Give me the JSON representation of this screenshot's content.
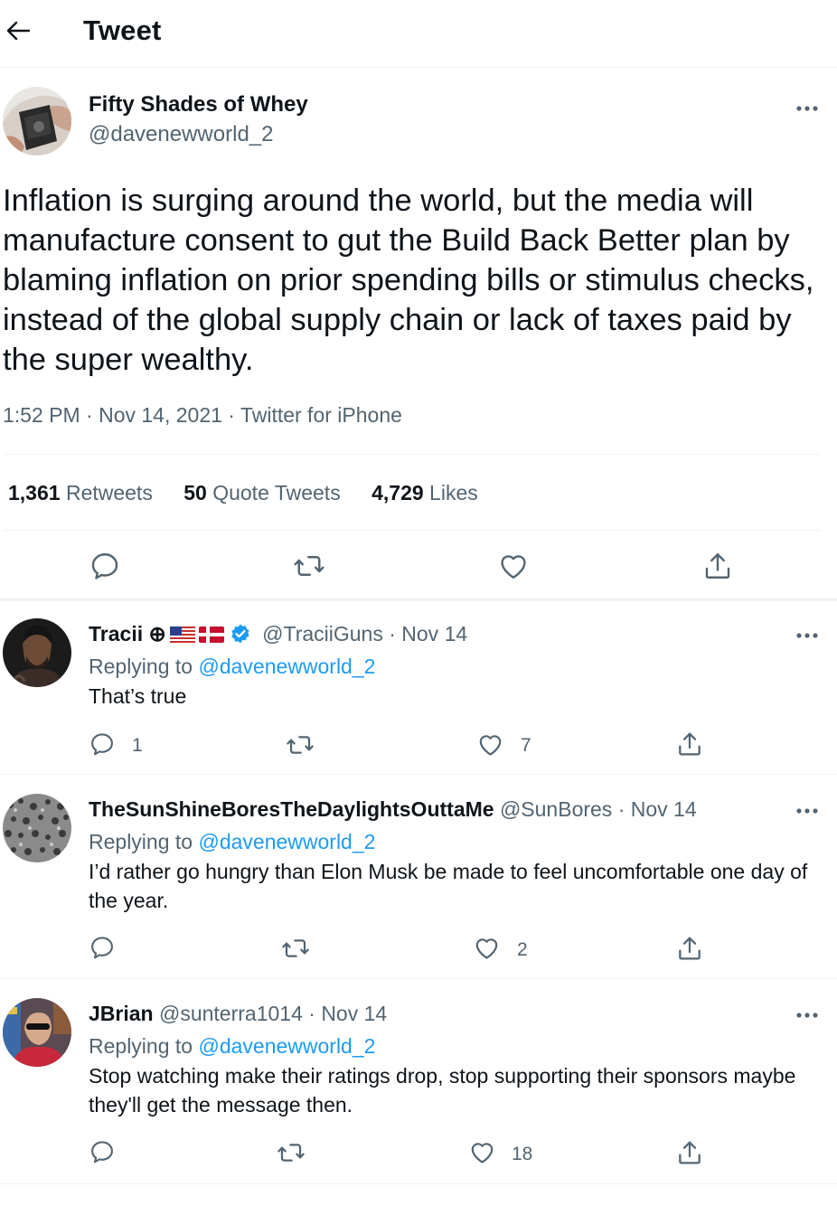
{
  "header": {
    "title": "Tweet"
  },
  "tweet": {
    "author_name": "Fifty Shades of Whey",
    "author_handle": "@davenewworld_2",
    "text": "Inflation is surging around the world, but the media will manufacture consent to gut the Build Back Better plan by blaming inflation on prior spending bills or stimulus checks, instead of the global supply chain or lack of taxes paid by the super wealthy.",
    "meta": "1:52 PM · Nov 14, 2021 · Twitter for iPhone",
    "stats": {
      "retweets_num": "1,361",
      "retweets_label": " Retweets",
      "quotes_num": "50",
      "quotes_label": " Quote Tweets",
      "likes_num": "4,729",
      "likes_label": " Likes"
    }
  },
  "replies": [
    {
      "name": "Tracii ⊕",
      "handle": "@TraciiGuns",
      "date": " · Nov 14",
      "replying_prefix": "Replying to ",
      "replying_to": "@davenewworld_2",
      "text": "That’s true",
      "reply_count": "1",
      "retweet_count": "",
      "like_count": "7"
    },
    {
      "name": "TheSunShineBoresTheDaylightsOuttaMe",
      "handle": " @SunBores",
      "date": " · Nov 14",
      "replying_prefix": "Replying to ",
      "replying_to": "@davenewworld_2",
      "text": "I’d rather go hungry than Elon Musk be made to feel uncomfortable one day of the year.",
      "reply_count": "",
      "retweet_count": "",
      "like_count": "2"
    },
    {
      "name": "JBrian",
      "handle": " @sunterra1014",
      "date": " · Nov 14",
      "replying_prefix": "Replying to ",
      "replying_to": "@davenewworld_2",
      "text": "Stop watching make their ratings drop, stop supporting their sponsors maybe they'll get the message then.",
      "reply_count": "",
      "retweet_count": "",
      "like_count": "18"
    }
  ],
  "icons": {
    "back": "arrow-left-icon",
    "reply": "speech-bubble-icon",
    "retweet": "retweet-arrows-icon",
    "like": "heart-icon",
    "share": "upload-icon",
    "more": "ellipsis-icon",
    "verified": "verified-badge-icon"
  },
  "colors": {
    "text": "#0f1419",
    "secondary": "#536471",
    "link": "#1d9bf0",
    "divider": "#eff3f4"
  }
}
